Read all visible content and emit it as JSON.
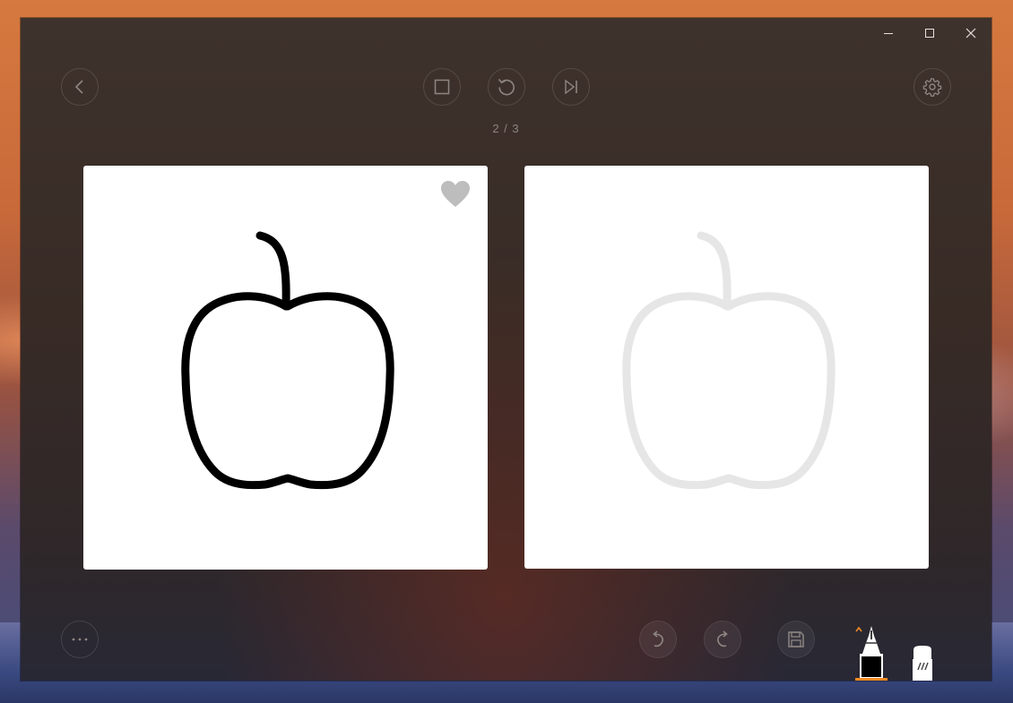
{
  "window": {
    "caption": {
      "minimize": "minimize",
      "maximize": "maximize",
      "close": "close"
    }
  },
  "toolbar": {
    "back_icon": "chevron-left-icon",
    "stop_icon": "square-stop-icon",
    "replay_icon": "replay-icon",
    "skip_icon": "skip-next-icon",
    "settings_icon": "gear-icon"
  },
  "progress": {
    "text": "2 / 3",
    "current": 2,
    "total": 3
  },
  "reference_card": {
    "subject_icon": "apple-icon",
    "favorite_icon": "heart-icon",
    "stroke_color": "#000000",
    "favorite_color": "#bdbdbd"
  },
  "drawing_card": {
    "guide_icon": "apple-icon",
    "guide_color": "#e6e6e6"
  },
  "bottom_bar": {
    "more_icon": "more-dots-icon",
    "undo_icon": "undo-icon",
    "redo_icon": "redo-icon",
    "save_icon": "save-icon",
    "pen_icon": "pen-tool-icon",
    "eraser_icon": "eraser-tool-icon",
    "active_tool": "pen",
    "accent_color": "#f08a24"
  }
}
